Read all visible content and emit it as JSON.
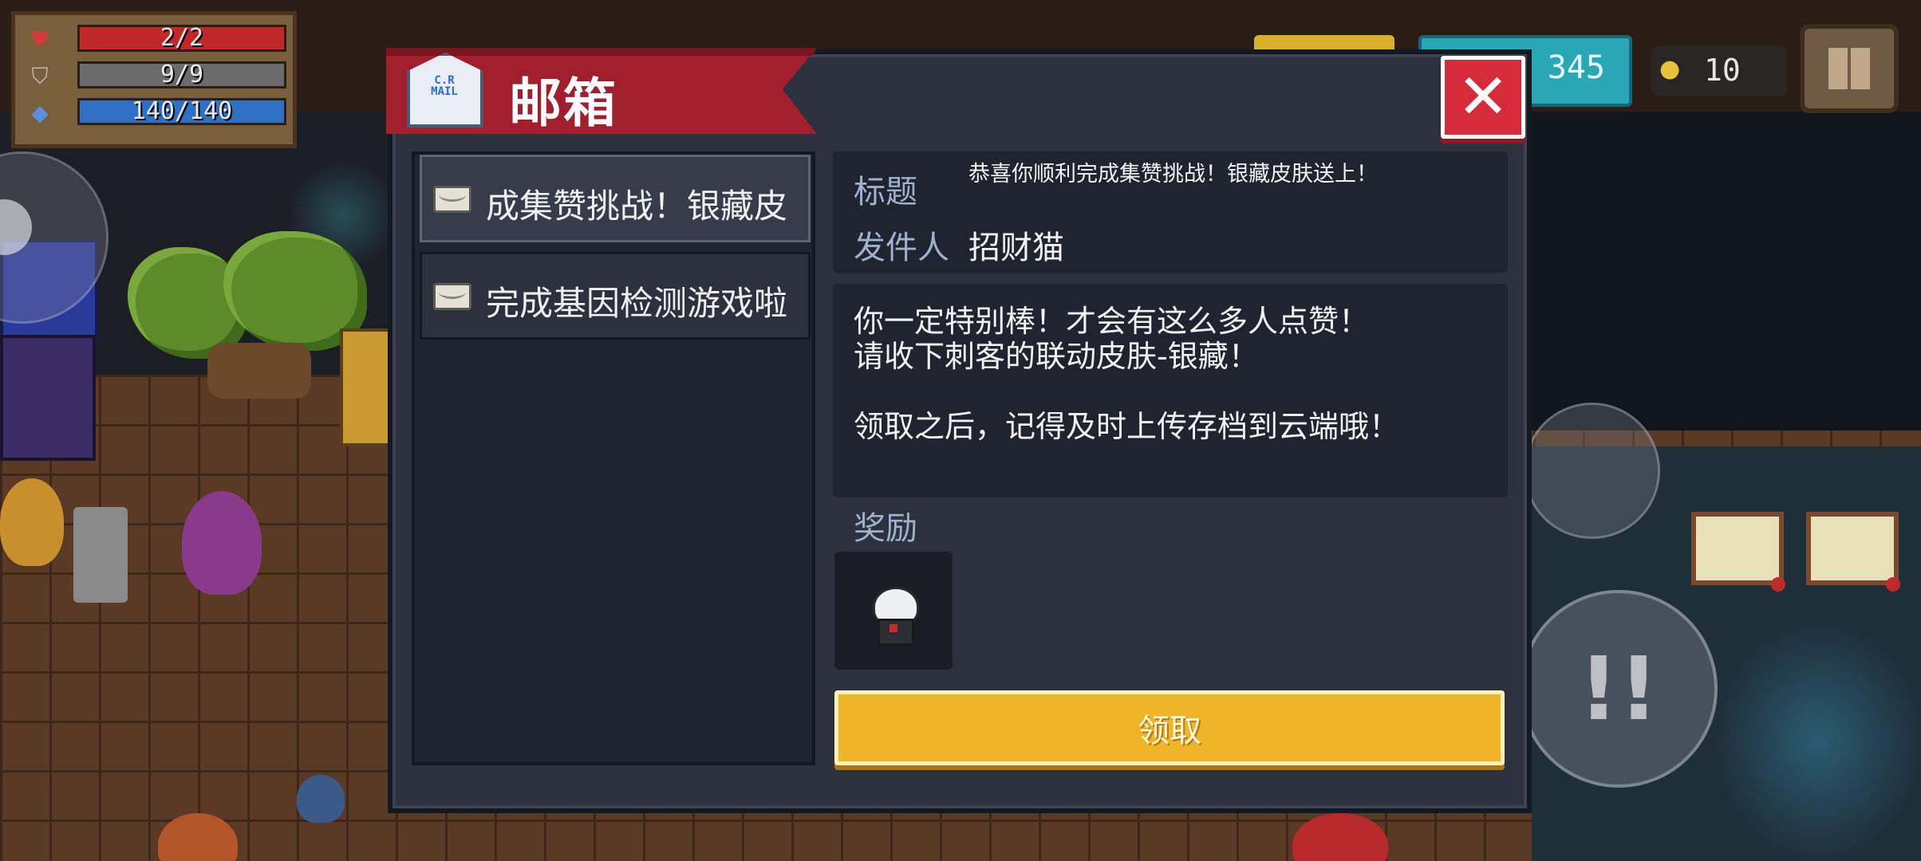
{
  "hud": {
    "health": {
      "text": "2/2",
      "fraction": 1.0,
      "color": "#c0282a"
    },
    "armor": {
      "text": "9/9",
      "fraction": 1.0,
      "color": "#6b6b6b"
    },
    "energy": {
      "text": "140/140",
      "fraction": 1.0,
      "color": "#2f6fc4"
    },
    "gems": "345",
    "coins": "10",
    "icons": {
      "health": "heart-icon",
      "armor": "shield-icon",
      "energy": "diamond-icon",
      "coin": "coin-icon",
      "pause": "pause-icon"
    }
  },
  "mailbox": {
    "title": "邮箱",
    "icon_label": "C.R\nMAIL",
    "close_icon": "close-icon",
    "mails": [
      {
        "title": "恭喜你顺利完成集赞挑战！银藏皮肤送上！",
        "visible_title": "成集赞挑战！银藏皮",
        "selected": true
      },
      {
        "title": "完成基因检测游戏啦",
        "visible_title": "完成基因检测游戏啦",
        "selected": false
      }
    ],
    "detail": {
      "subject_label": "标题",
      "subject": "恭喜你顺利完成集赞挑战！银藏皮肤送上！",
      "sender_label": "发件人",
      "sender": "招财猫",
      "body_lines": [
        "你一定特别棒！才会有这么多人点赞！",
        "请收下刺客的联动皮肤-银藏！",
        "",
        "领取之后，记得及时上传存档到云端哦！"
      ],
      "reward_label": "奖励",
      "claim_label": "领取"
    }
  },
  "colors": {
    "accent_red": "#a11f2c",
    "claim_yellow": "#f0b429",
    "panel": "#2c313d"
  }
}
